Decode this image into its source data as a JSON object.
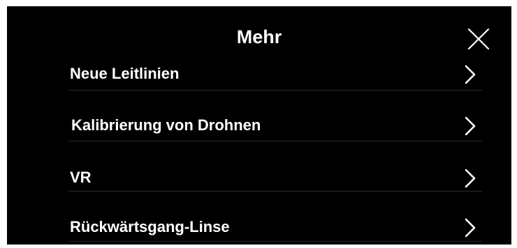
{
  "dialog": {
    "title": "Mehr",
    "close_icon": "close-icon"
  },
  "menu": {
    "items": [
      {
        "label": "Neue Leitlinien",
        "icon": "chevron-right-icon"
      },
      {
        "label": "Kalibrierung von Drohnen",
        "icon": "chevron-right-icon"
      },
      {
        "label": "VR",
        "icon": "chevron-right-icon"
      },
      {
        "label": "Rückwärtsgang-Linse",
        "icon": "chevron-right-icon"
      }
    ]
  },
  "colors": {
    "background": "#000000",
    "text": "#ffffff",
    "divider": "#2a2a2a"
  }
}
